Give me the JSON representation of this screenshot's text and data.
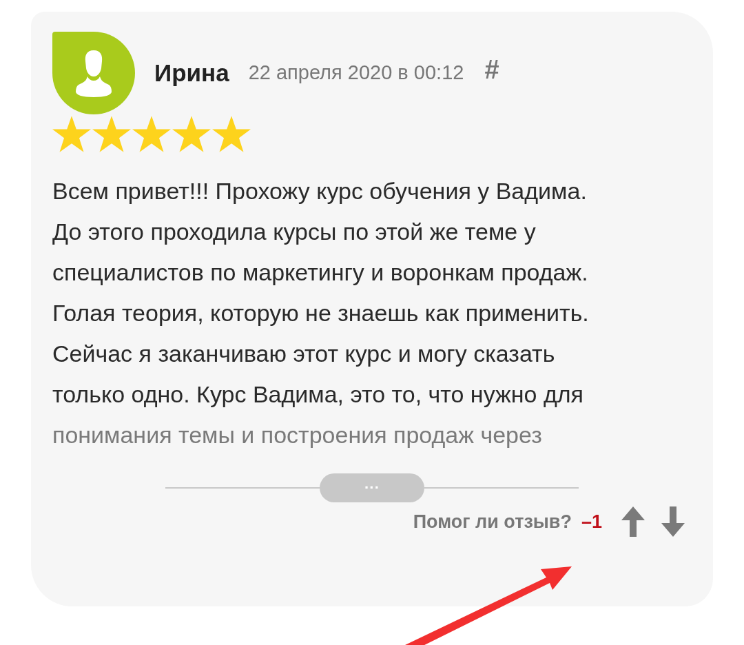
{
  "review": {
    "author": "Ирина",
    "date": "22 апреля 2020 в 00:12",
    "permalink": "#",
    "stars": 5,
    "text_lines": [
      "Всем привет!!! Прохожу курс обучения у Вадима.",
      "До этого проходила курсы по этой же теме у",
      "специалистов по маркетингу и воронкам продаж.",
      "Голая теория, которую не знаешь как применить.",
      "Сейчас я заканчиваю этот курс и могу сказать",
      "только одно. Курс Вадима, это то, что нужно для",
      "понимания темы и построения продаж через"
    ],
    "expand": "···",
    "helpful": {
      "question": "Помог ли отзыв?",
      "score": "–1"
    }
  }
}
